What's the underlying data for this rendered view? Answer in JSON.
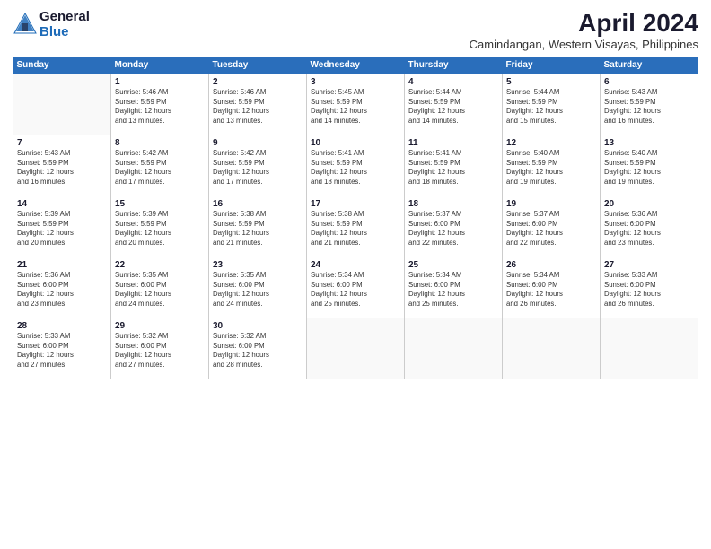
{
  "header": {
    "logo_line1": "General",
    "logo_line2": "Blue",
    "month": "April 2024",
    "location": "Camindangan, Western Visayas, Philippines"
  },
  "weekdays": [
    "Sunday",
    "Monday",
    "Tuesday",
    "Wednesday",
    "Thursday",
    "Friday",
    "Saturday"
  ],
  "weeks": [
    [
      {
        "day": "",
        "info": ""
      },
      {
        "day": "1",
        "info": "Sunrise: 5:46 AM\nSunset: 5:59 PM\nDaylight: 12 hours\nand 13 minutes."
      },
      {
        "day": "2",
        "info": "Sunrise: 5:46 AM\nSunset: 5:59 PM\nDaylight: 12 hours\nand 13 minutes."
      },
      {
        "day": "3",
        "info": "Sunrise: 5:45 AM\nSunset: 5:59 PM\nDaylight: 12 hours\nand 14 minutes."
      },
      {
        "day": "4",
        "info": "Sunrise: 5:44 AM\nSunset: 5:59 PM\nDaylight: 12 hours\nand 14 minutes."
      },
      {
        "day": "5",
        "info": "Sunrise: 5:44 AM\nSunset: 5:59 PM\nDaylight: 12 hours\nand 15 minutes."
      },
      {
        "day": "6",
        "info": "Sunrise: 5:43 AM\nSunset: 5:59 PM\nDaylight: 12 hours\nand 16 minutes."
      }
    ],
    [
      {
        "day": "7",
        "info": "Sunrise: 5:43 AM\nSunset: 5:59 PM\nDaylight: 12 hours\nand 16 minutes."
      },
      {
        "day": "8",
        "info": "Sunrise: 5:42 AM\nSunset: 5:59 PM\nDaylight: 12 hours\nand 17 minutes."
      },
      {
        "day": "9",
        "info": "Sunrise: 5:42 AM\nSunset: 5:59 PM\nDaylight: 12 hours\nand 17 minutes."
      },
      {
        "day": "10",
        "info": "Sunrise: 5:41 AM\nSunset: 5:59 PM\nDaylight: 12 hours\nand 18 minutes."
      },
      {
        "day": "11",
        "info": "Sunrise: 5:41 AM\nSunset: 5:59 PM\nDaylight: 12 hours\nand 18 minutes."
      },
      {
        "day": "12",
        "info": "Sunrise: 5:40 AM\nSunset: 5:59 PM\nDaylight: 12 hours\nand 19 minutes."
      },
      {
        "day": "13",
        "info": "Sunrise: 5:40 AM\nSunset: 5:59 PM\nDaylight: 12 hours\nand 19 minutes."
      }
    ],
    [
      {
        "day": "14",
        "info": "Sunrise: 5:39 AM\nSunset: 5:59 PM\nDaylight: 12 hours\nand 20 minutes."
      },
      {
        "day": "15",
        "info": "Sunrise: 5:39 AM\nSunset: 5:59 PM\nDaylight: 12 hours\nand 20 minutes."
      },
      {
        "day": "16",
        "info": "Sunrise: 5:38 AM\nSunset: 5:59 PM\nDaylight: 12 hours\nand 21 minutes."
      },
      {
        "day": "17",
        "info": "Sunrise: 5:38 AM\nSunset: 5:59 PM\nDaylight: 12 hours\nand 21 minutes."
      },
      {
        "day": "18",
        "info": "Sunrise: 5:37 AM\nSunset: 6:00 PM\nDaylight: 12 hours\nand 22 minutes."
      },
      {
        "day": "19",
        "info": "Sunrise: 5:37 AM\nSunset: 6:00 PM\nDaylight: 12 hours\nand 22 minutes."
      },
      {
        "day": "20",
        "info": "Sunrise: 5:36 AM\nSunset: 6:00 PM\nDaylight: 12 hours\nand 23 minutes."
      }
    ],
    [
      {
        "day": "21",
        "info": "Sunrise: 5:36 AM\nSunset: 6:00 PM\nDaylight: 12 hours\nand 23 minutes."
      },
      {
        "day": "22",
        "info": "Sunrise: 5:35 AM\nSunset: 6:00 PM\nDaylight: 12 hours\nand 24 minutes."
      },
      {
        "day": "23",
        "info": "Sunrise: 5:35 AM\nSunset: 6:00 PM\nDaylight: 12 hours\nand 24 minutes."
      },
      {
        "day": "24",
        "info": "Sunrise: 5:34 AM\nSunset: 6:00 PM\nDaylight: 12 hours\nand 25 minutes."
      },
      {
        "day": "25",
        "info": "Sunrise: 5:34 AM\nSunset: 6:00 PM\nDaylight: 12 hours\nand 25 minutes."
      },
      {
        "day": "26",
        "info": "Sunrise: 5:34 AM\nSunset: 6:00 PM\nDaylight: 12 hours\nand 26 minutes."
      },
      {
        "day": "27",
        "info": "Sunrise: 5:33 AM\nSunset: 6:00 PM\nDaylight: 12 hours\nand 26 minutes."
      }
    ],
    [
      {
        "day": "28",
        "info": "Sunrise: 5:33 AM\nSunset: 6:00 PM\nDaylight: 12 hours\nand 27 minutes."
      },
      {
        "day": "29",
        "info": "Sunrise: 5:32 AM\nSunset: 6:00 PM\nDaylight: 12 hours\nand 27 minutes."
      },
      {
        "day": "30",
        "info": "Sunrise: 5:32 AM\nSunset: 6:00 PM\nDaylight: 12 hours\nand 28 minutes."
      },
      {
        "day": "",
        "info": ""
      },
      {
        "day": "",
        "info": ""
      },
      {
        "day": "",
        "info": ""
      },
      {
        "day": "",
        "info": ""
      }
    ]
  ]
}
